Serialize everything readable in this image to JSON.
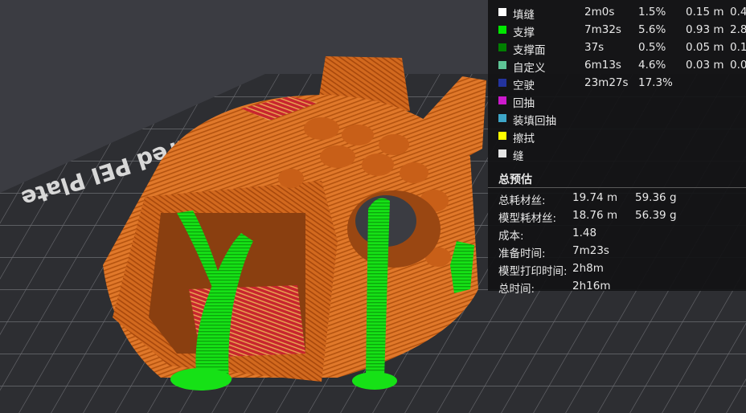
{
  "viewport": {
    "plate_label": "Textured PEI Plate"
  },
  "legend": {
    "rows": [
      {
        "name": "填缝",
        "time": "2m0s",
        "pct": "1.5%",
        "length": "0.15 m",
        "weight": "0.4",
        "color": "#ffffff"
      },
      {
        "name": "支撑",
        "time": "7m32s",
        "pct": "5.6%",
        "length": "0.93 m",
        "weight": "2.8",
        "color": "#00e600"
      },
      {
        "name": "支撑面",
        "time": "37s",
        "pct": "0.5%",
        "length": "0.05 m",
        "weight": "0.1",
        "color": "#008000"
      },
      {
        "name": "自定义",
        "time": "6m13s",
        "pct": "4.6%",
        "length": "0.03 m",
        "weight": "0.0",
        "color": "#5ec496"
      },
      {
        "name": "空驶",
        "time": "23m27s",
        "pct": "17.3%",
        "length": "",
        "weight": "",
        "color": "#23339e"
      },
      {
        "name": "回抽",
        "time": "",
        "pct": "",
        "length": "",
        "weight": "",
        "color": "#cc1acc"
      },
      {
        "name": "装填回抽",
        "time": "",
        "pct": "",
        "length": "",
        "weight": "",
        "color": "#3ea6c8"
      },
      {
        "name": "擦拭",
        "time": "",
        "pct": "",
        "length": "",
        "weight": "",
        "color": "#ffff00"
      },
      {
        "name": "缝",
        "time": "",
        "pct": "",
        "length": "",
        "weight": "",
        "color": "#e5e5e5"
      }
    ]
  },
  "summary": {
    "title": "总预估",
    "rows": [
      {
        "label": "总耗材丝:",
        "v1": "19.74 m",
        "v2": "59.36 g"
      },
      {
        "label": "模型耗材丝:",
        "v1": "18.76 m",
        "v2": "56.39 g"
      },
      {
        "label": "成本:",
        "v1": "1.48",
        "v2": ""
      },
      {
        "label": "准备时间:",
        "v1": "7m23s",
        "v2": ""
      },
      {
        "label": "模型打印时间:",
        "v1": "2h8m",
        "v2": ""
      },
      {
        "label": "总时间:",
        "v1": "2h16m",
        "v2": ""
      }
    ]
  }
}
